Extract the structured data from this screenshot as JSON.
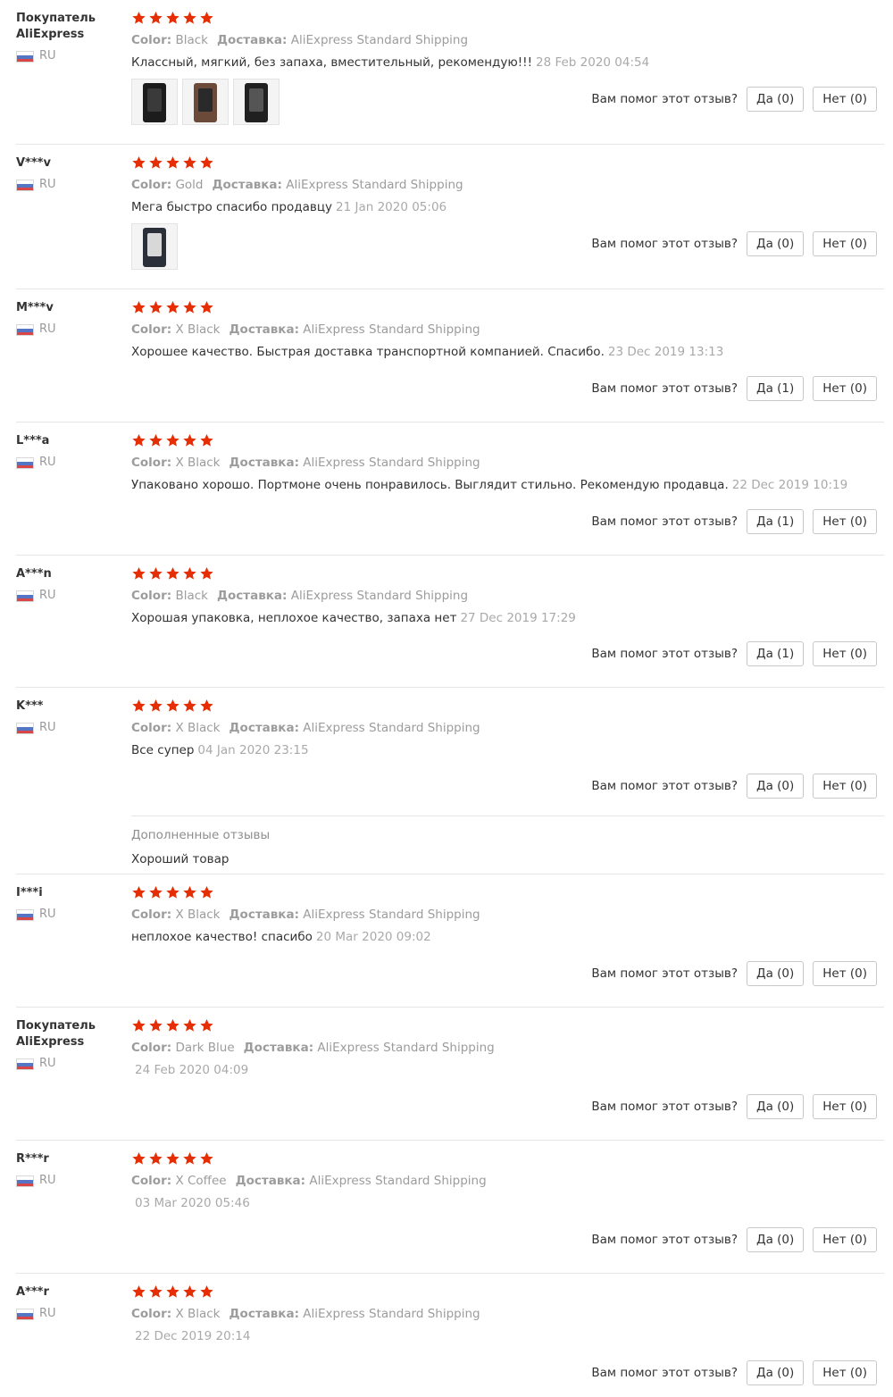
{
  "colors": {
    "star": "#e62e04",
    "label": "#9c9c9c",
    "divider": "#e6e6e6"
  },
  "labels": {
    "color": "Color:",
    "shipping": "Доставка:",
    "helpful_question": "Вам помог этот отзыв?",
    "yes": "Да",
    "no": "Нет",
    "additional_title": "Дополненные отзывы"
  },
  "reviews": [
    {
      "user": "Покупатель AliExpress",
      "country": "RU",
      "rating": 5,
      "color": "Black",
      "shipping": "AliExpress Standard Shipping",
      "text": "Классный, мягкий, без запаха, вместительный, рекомендую!!!",
      "date": "28 Feb 2020 04:54",
      "photos": 3,
      "yes": "Да (0)",
      "no": "Нет (0)"
    },
    {
      "user": "V***v",
      "country": "RU",
      "rating": 5,
      "color": "Gold",
      "shipping": "AliExpress Standard Shipping",
      "text": "Мега быстро спасибо продавцу",
      "date": "21 Jan 2020 05:06",
      "photos": 1,
      "yes": "Да (0)",
      "no": "Нет (0)"
    },
    {
      "user": "M***v",
      "country": "RU",
      "rating": 5,
      "color": "X Black",
      "shipping": "AliExpress Standard Shipping",
      "text": "Хорошее качество. Быстрая доставка транспортной компанией. Спасибо.",
      "date": "23 Dec 2019 13:13",
      "photos": 0,
      "yes": "Да (1)",
      "no": "Нет (0)"
    },
    {
      "user": "L***a",
      "country": "RU",
      "rating": 5,
      "color": "X Black",
      "shipping": "AliExpress Standard Shipping",
      "text": "Упаковано хорошо. Портмоне очень понравилось. Выглядит стильно. Рекомендую продавца.",
      "date": "22 Dec 2019 10:19",
      "photos": 0,
      "yes": "Да (1)",
      "no": "Нет (0)"
    },
    {
      "user": "A***n",
      "country": "RU",
      "rating": 5,
      "color": "Black",
      "shipping": "AliExpress Standard Shipping",
      "text": "Хорошая упаковка, неплохое качество, запаха нет",
      "date": "27 Dec 2019 17:29",
      "photos": 0,
      "yes": "Да (1)",
      "no": "Нет (0)"
    },
    {
      "user": "K***",
      "country": "RU",
      "rating": 5,
      "color": "X Black",
      "shipping": "AliExpress Standard Shipping",
      "text": "Все супер",
      "date": "04 Jan 2020 23:15",
      "photos": 0,
      "yes": "Да (0)",
      "no": "Нет (0)",
      "additional_text": "Хороший товар"
    },
    {
      "user": "I***i",
      "country": "RU",
      "rating": 5,
      "color": "X Black",
      "shipping": "AliExpress Standard Shipping",
      "text": "неплохое качество! спасибо",
      "date": "20 Mar 2020 09:02",
      "photos": 0,
      "yes": "Да (0)",
      "no": "Нет (0)"
    },
    {
      "user": "Покупатель AliExpress",
      "country": "RU",
      "rating": 5,
      "color": "Dark Blue",
      "shipping": "AliExpress Standard Shipping",
      "text": "",
      "date": "24 Feb 2020 04:09",
      "photos": 0,
      "yes": "Да (0)",
      "no": "Нет (0)"
    },
    {
      "user": "R***r",
      "country": "RU",
      "rating": 5,
      "color": "X Coffee",
      "shipping": "AliExpress Standard Shipping",
      "text": "",
      "date": "03 Mar 2020 05:46",
      "photos": 0,
      "yes": "Да (0)",
      "no": "Нет (0)"
    },
    {
      "user": "A***r",
      "country": "RU",
      "rating": 5,
      "color": "X Black",
      "shipping": "AliExpress Standard Shipping",
      "text": "",
      "date": "22 Dec 2019 20:14",
      "photos": 0,
      "yes": "Да (0)",
      "no": "Нет (0)"
    }
  ]
}
